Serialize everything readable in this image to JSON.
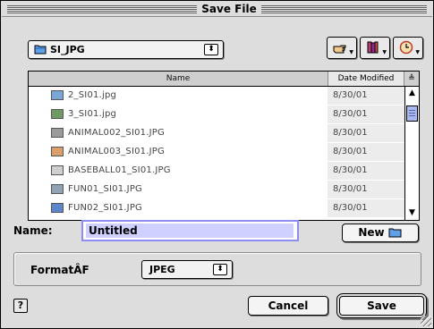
{
  "window": {
    "title": "Save File"
  },
  "folder_popup": {
    "label": "SI_JPG",
    "icon": "folder-icon"
  },
  "toolbar": {
    "buttons": [
      {
        "icon": "pointing-hand-icon"
      },
      {
        "icon": "books-icon"
      },
      {
        "icon": "clock-icon"
      }
    ]
  },
  "file_list": {
    "columns": {
      "name": "Name",
      "date": "Date Modified",
      "sort": "≜"
    },
    "rows": [
      {
        "name": "2_SI01.jpg",
        "date": "8/30/01",
        "thumb": "#7aa7d8"
      },
      {
        "name": "3_SI01.jpg",
        "date": "8/30/01",
        "thumb": "#6f9a63"
      },
      {
        "name": "ANIMAL002_SI01.JPG",
        "date": "8/30/01",
        "thumb": "#9a9a9a"
      },
      {
        "name": "ANIMAL003_SI01.JPG",
        "date": "8/30/01",
        "thumb": "#d9a06a"
      },
      {
        "name": "BASEBALL01_SI01.JPG",
        "date": "8/30/01",
        "thumb": "#cfcfcf"
      },
      {
        "name": "FUN01_SI01.JPG",
        "date": "8/30/01",
        "thumb": "#8fa3b4"
      },
      {
        "name": "FUN02_SI01.JPG",
        "date": "8/30/01",
        "thumb": "#5b86c9"
      }
    ]
  },
  "name_field": {
    "label": "Name:",
    "value": "Untitled"
  },
  "new_button": {
    "label": "New"
  },
  "format": {
    "label": "FormatÂF",
    "value": "JPEG"
  },
  "buttons": {
    "help": "?",
    "cancel": "Cancel",
    "save": "Save"
  }
}
